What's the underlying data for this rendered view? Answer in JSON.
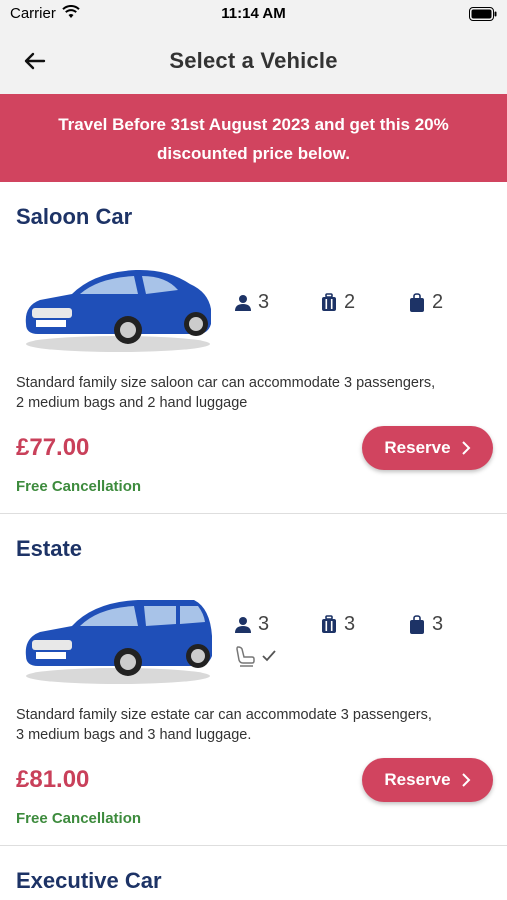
{
  "status_bar": {
    "carrier": "Carrier",
    "time": "11:14 AM"
  },
  "nav": {
    "title": "Select a Vehicle"
  },
  "banner": {
    "line1": "Travel Before 31st August 2023 and get this 20%",
    "line2": "discounted price below."
  },
  "vehicles": [
    {
      "name": "Saloon Car",
      "passengers": "3",
      "luggage": "2",
      "hand_luggage": "2",
      "description_line1": "Standard family size saloon car can accommodate 3 passengers,",
      "description_line2": "2 medium bags and 2 hand luggage",
      "price": "£77.00",
      "cancellation": "Free Cancellation",
      "reserve_label": "Reserve"
    },
    {
      "name": "Estate",
      "passengers": "3",
      "luggage": "3",
      "hand_luggage": "3",
      "description_line1": "Standard family size estate car can accommodate 3 passengers,",
      "description_line2": "3 medium bags and 3 hand luggage.",
      "price": "£81.00",
      "cancellation": "Free Cancellation",
      "reserve_label": "Reserve"
    },
    {
      "name": "Executive Car"
    }
  ],
  "colors": {
    "accent": "#d1445f",
    "heading": "#1d3366",
    "price": "#c9405a",
    "success": "#3d8b3d",
    "car_body": "#1f4fb8"
  }
}
